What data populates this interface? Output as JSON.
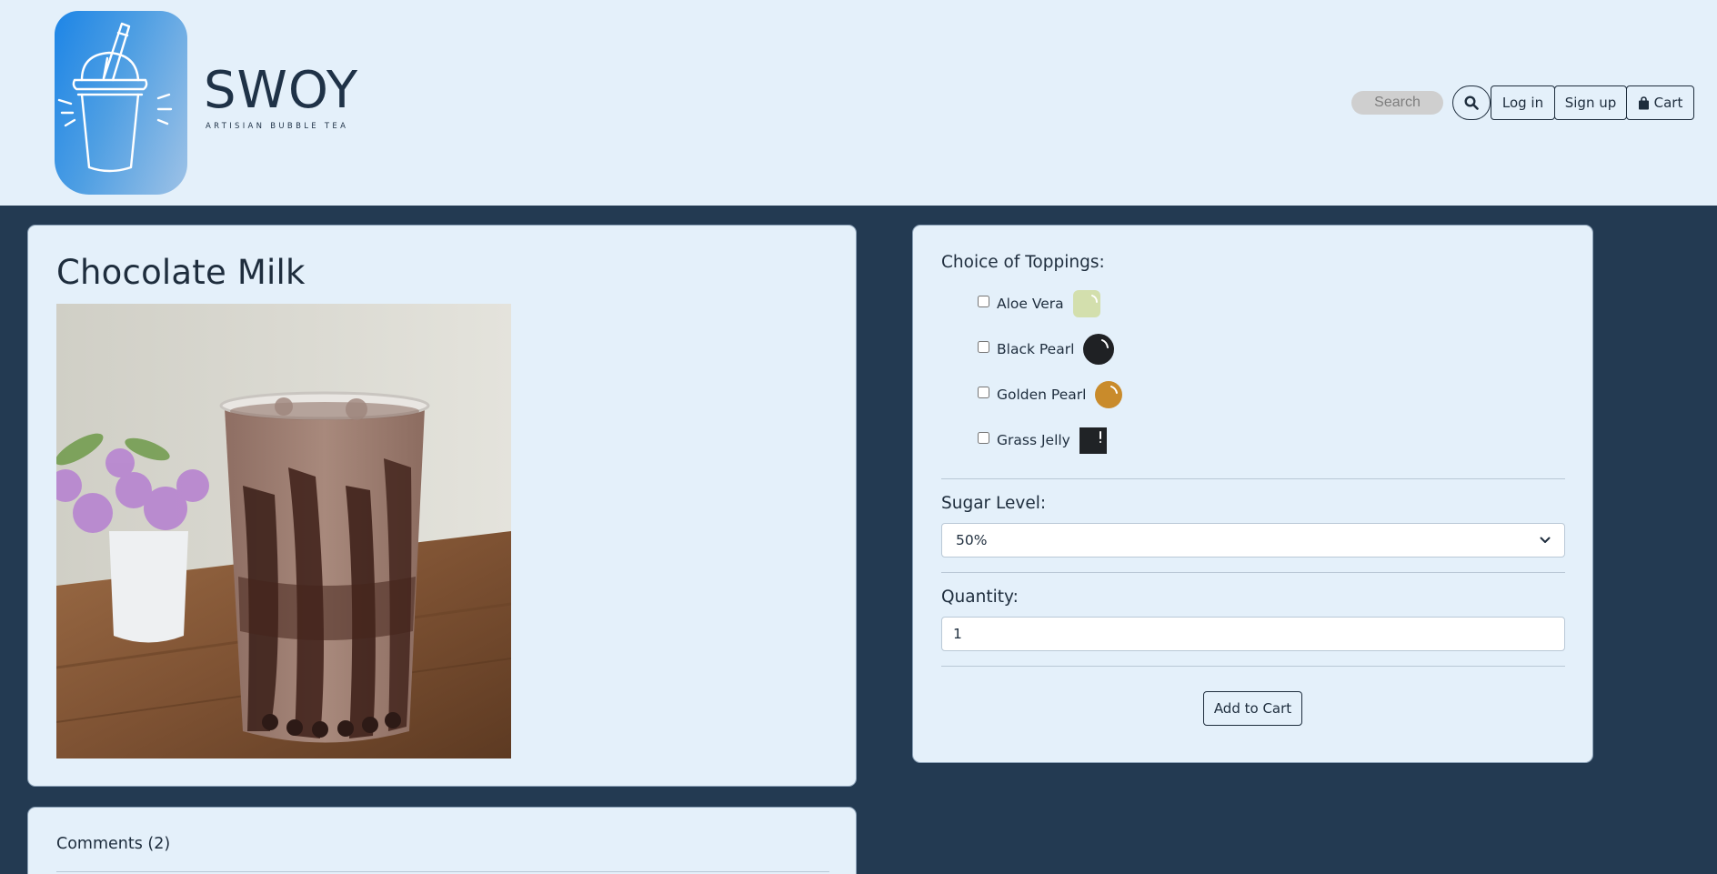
{
  "header": {
    "brand_name": "SWOY",
    "brand_tagline": "ARTISIAN BUBBLE TEA",
    "search_placeholder": "Search",
    "login_label": "Log in",
    "signup_label": "Sign up",
    "cart_label": "Cart"
  },
  "product": {
    "title": "Chocolate Milk"
  },
  "options": {
    "toppings_heading": "Choice of Toppings:",
    "toppings": [
      {
        "label": "Aloe Vera",
        "color": "#d3dfad",
        "checked": false
      },
      {
        "label": "Black Pearl",
        "color": "#1f2124",
        "checked": false
      },
      {
        "label": "Golden Pearl",
        "color": "#c98b2b",
        "checked": false
      },
      {
        "label": "Grass Jelly",
        "color": "#202326",
        "checked": false
      }
    ],
    "sugar_heading": "Sugar Level:",
    "sugar_value": "50%",
    "quantity_heading": "Quantity:",
    "quantity_value": "1",
    "add_to_cart_label": "Add to Cart"
  },
  "comments": {
    "title": "Comments (2)"
  },
  "colors": {
    "page_background": "#233a52",
    "card_background": "#e4f0fa",
    "text": "#1e2d3d"
  }
}
